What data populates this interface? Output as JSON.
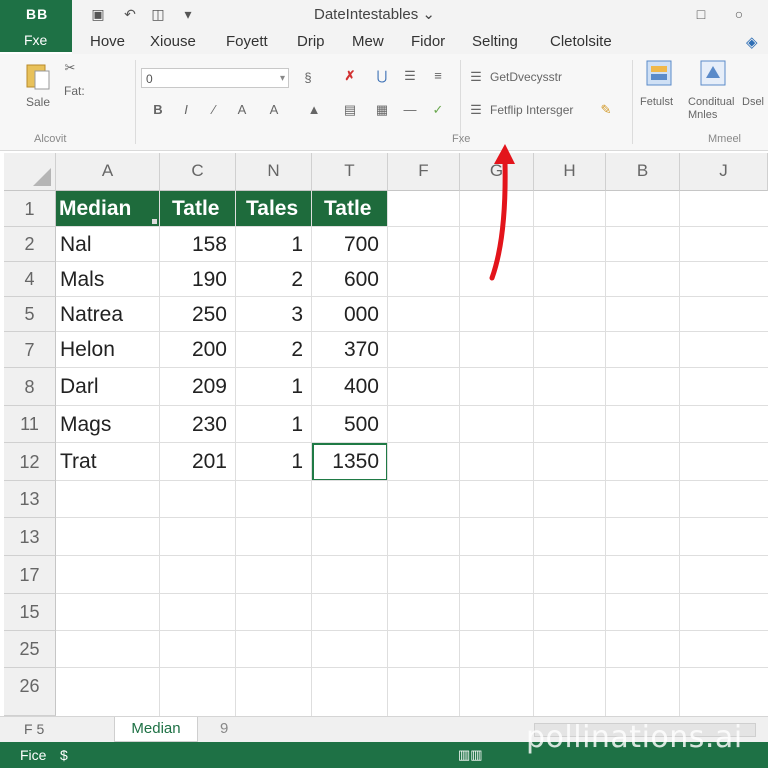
{
  "titlebar": {
    "app_badge_top": "BB",
    "app_badge_bottom": "Fxe",
    "doc_title": "DateIntestables ⌄",
    "qat_icons": [
      "save-icon",
      "undo-icon",
      "redo-icon",
      "dropdown-icon"
    ],
    "window_icons": [
      "restore-icon",
      "close-icon"
    ]
  },
  "menu": {
    "tabs": [
      "Hove",
      "Xiouse",
      "Foyett",
      "Drip",
      "Mew",
      "Fidor",
      "Selting",
      "Cletolsite"
    ]
  },
  "ribbon": {
    "paste_label": "Sale",
    "clipboard_items": [
      "Fat:"
    ],
    "clipboard_group": "Alcovit",
    "font_name": "0",
    "font_group": "Fxe",
    "cond_items": [
      "GetDvecysstr",
      "Fetflip Intersger"
    ],
    "styles_labels": [
      "Fetulst",
      "Conditual Mnles",
      "Dsel"
    ],
    "styles_group": "Mmeel"
  },
  "grid": {
    "columns": [
      "A",
      "C",
      "N",
      "T",
      "F",
      "G",
      "H",
      "B",
      "J"
    ],
    "rows": [
      "1",
      "2",
      "4",
      "5",
      "7",
      "8",
      "11",
      "12",
      "13",
      "13",
      "17",
      "15",
      "25",
      "26"
    ],
    "header_row": [
      "Median",
      "Tatle",
      "Tales",
      "Tatle"
    ],
    "data": [
      [
        "Nal",
        "158",
        "1",
        "700"
      ],
      [
        "Mals",
        "190",
        "2",
        "600"
      ],
      [
        "Natrea",
        "250",
        "3",
        "000"
      ],
      [
        "Helon",
        "200",
        "2",
        "370"
      ],
      [
        "Darl",
        "209",
        "1",
        "400"
      ],
      [
        "Mags",
        "230",
        "1",
        "500"
      ],
      [
        "Trat",
        "201",
        "1",
        "1350"
      ]
    ],
    "selected_cell": "T12"
  },
  "sheets": {
    "nav": "F 5",
    "tabs": [
      "Median"
    ],
    "add": "9"
  },
  "status": {
    "left": "Fice",
    "icons": [
      "page-layout-icon",
      "view-icon"
    ]
  },
  "watermark": "pollinations.ai",
  "colors": {
    "brand": "#1e7145",
    "header_fill": "#1e6b3c",
    "arrow": "#e3141b"
  }
}
